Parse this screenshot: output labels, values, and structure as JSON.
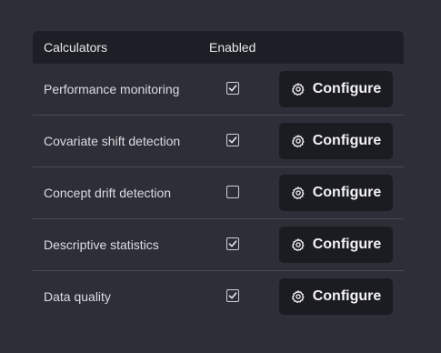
{
  "table": {
    "headers": {
      "calculators": "Calculators",
      "enabled": "Enabled"
    },
    "rows": [
      {
        "label": "Performance monitoring",
        "enabled": true,
        "button": "Configure"
      },
      {
        "label": "Covariate shift detection",
        "enabled": true,
        "button": "Configure"
      },
      {
        "label": "Concept drift detection",
        "enabled": false,
        "button": "Configure"
      },
      {
        "label": "Descriptive statistics",
        "enabled": true,
        "button": "Configure"
      },
      {
        "label": "Data quality",
        "enabled": true,
        "button": "Configure"
      }
    ]
  },
  "icons": {
    "gear": "gear-icon",
    "check": "check-icon"
  },
  "colors": {
    "background": "#2e2e38",
    "header_bg": "#1e1f26",
    "button_bg": "#1b1c22",
    "divider": "#4a4b55"
  }
}
